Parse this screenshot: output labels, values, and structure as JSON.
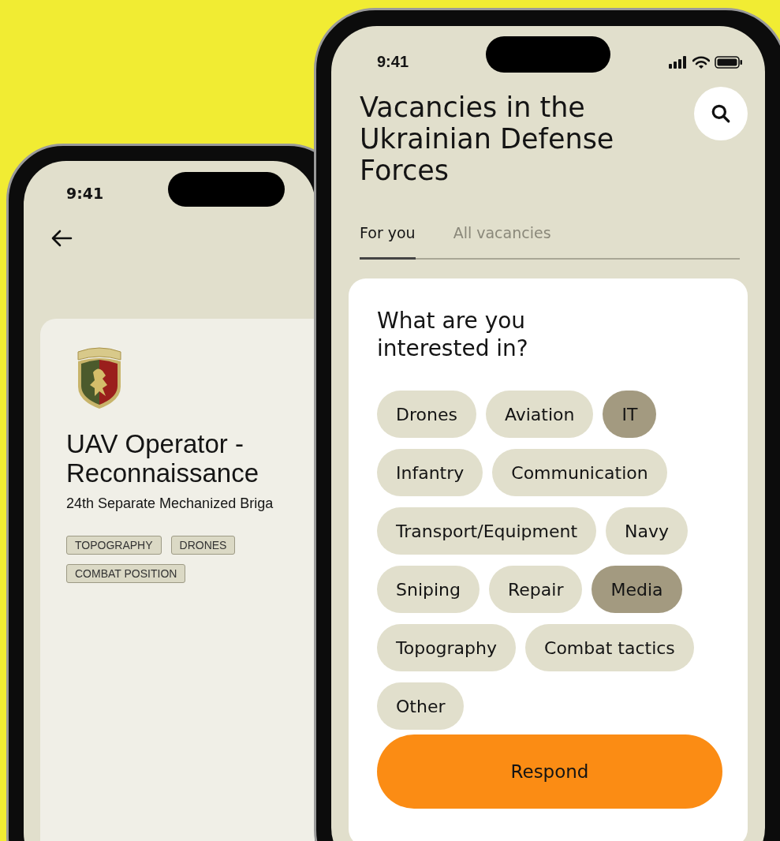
{
  "left_phone": {
    "status_time": "9:41",
    "job": {
      "title": "UAV Operator - Reconnaissance",
      "unit": "24th Separate Mechanized Briga",
      "tags": [
        "TOPOGRAPHY",
        "DRONES",
        "COMBAT POSITION"
      ]
    }
  },
  "right_phone": {
    "status_time": "9:41",
    "title": "Vacancies in the Ukrainian Defense Forces",
    "tabs": [
      {
        "label": "For you",
        "selected": true
      },
      {
        "label": "All vacancies",
        "selected": false
      }
    ],
    "card": {
      "question": "What are you interested in?",
      "chips": [
        {
          "label": "Drones",
          "selected": false
        },
        {
          "label": "Aviation",
          "selected": false
        },
        {
          "label": "IT",
          "selected": true
        },
        {
          "label": "Infantry",
          "selected": false
        },
        {
          "label": "Communication",
          "selected": false
        },
        {
          "label": "Transport/Equipment",
          "selected": false
        },
        {
          "label": "Navy",
          "selected": false
        },
        {
          "label": "Sniping",
          "selected": false
        },
        {
          "label": "Repair",
          "selected": false
        },
        {
          "label": "Media",
          "selected": true
        },
        {
          "label": "Topography",
          "selected": false
        },
        {
          "label": "Combat tactics",
          "selected": false
        },
        {
          "label": "Other",
          "selected": false
        }
      ],
      "respond_button": "Respond"
    }
  }
}
